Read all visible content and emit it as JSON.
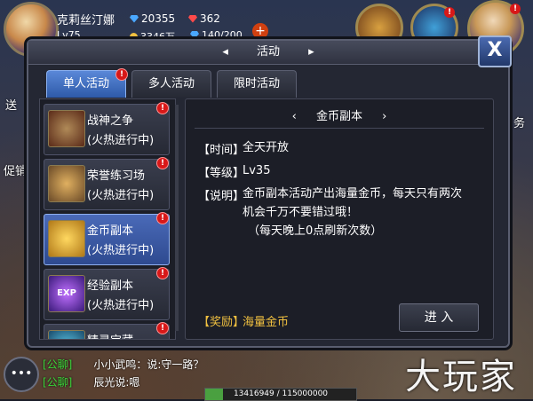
{
  "player": {
    "name": "克莉丝汀娜",
    "level": "Lv75",
    "diamonds": "20355",
    "rubies": "362",
    "gold": "3346万",
    "stamina": "140/200"
  },
  "side_buttons": {
    "left_top": "送",
    "left_bottom": "促销",
    "right": "务"
  },
  "dialog": {
    "title": "活动",
    "close_label": "X",
    "tabs": [
      {
        "label": "单人活动",
        "active": true,
        "badge": "!"
      },
      {
        "label": "多人活动",
        "active": false,
        "badge": ""
      },
      {
        "label": "限时活动",
        "active": false,
        "badge": ""
      }
    ],
    "activities": [
      {
        "name": "战神之争",
        "status": "(火热进行中)",
        "icon": "helmet-icon",
        "badge": "!"
      },
      {
        "name": "荣誉练习场",
        "status": "(火热进行中)",
        "icon": "warrior-icon",
        "badge": "!"
      },
      {
        "name": "金币副本",
        "status": "(火热进行中)",
        "icon": "gold-coins-icon",
        "badge": "!",
        "selected": true
      },
      {
        "name": "经验副本",
        "status": "(火热进行中)",
        "icon": "exp-icon",
        "badge": "!"
      },
      {
        "name": "精灵宝藏",
        "status": "",
        "icon": "treasure-icon",
        "badge": "!"
      }
    ],
    "detail": {
      "title": "金币副本",
      "time_label": "【时间】",
      "time_value": "全天开放",
      "level_label": "【等级】",
      "level_value": "Lv35",
      "desc_label": "【说明】",
      "desc_line1": "金币副本活动产出海量金币，每天只有两次",
      "desc_line2": "机会千万不要错过哦！",
      "desc_line3": "（每天晚上0点刷新次数）",
      "reward_label": "【奖励】",
      "reward_value": "海量金币",
      "enter_label": "进 入"
    }
  },
  "chat": {
    "lines": [
      {
        "channel": "[公聊]",
        "text": "小小武鸣：说:守一路？"
      },
      {
        "channel": "[公聊]",
        "text": "辰光说:嗯"
      }
    ]
  },
  "exp": {
    "text": "13416949 / 115000000",
    "fraction": 0.117
  },
  "watermark": "大玩家"
}
